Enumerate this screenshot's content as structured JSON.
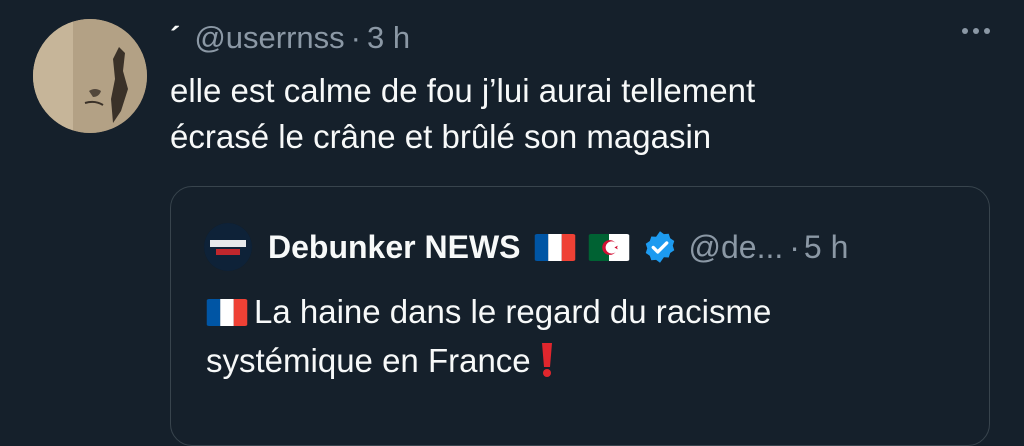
{
  "tweet": {
    "display_name": "´",
    "handle": "@userrnss",
    "separator": "·",
    "time": "3 h",
    "text_line1": "elle est calme de fou j’lui aurai tellement",
    "text_line2": "écrasé le crâne et brûlé son magasin",
    "more_icon": "ellipsis-icon"
  },
  "quote": {
    "avatar_label": "DEBUNKER NEWS",
    "display_name": "Debunker NEWS",
    "flags": [
      "france-flag-icon",
      "algeria-flag-icon"
    ],
    "verified_icon": "verified-badge-icon",
    "verified_color": "#1d9bf0",
    "handle": "@de...",
    "separator": "·",
    "time": "5 h",
    "text_line1": "La haine dans le regard du racisme",
    "text_line2": "systémique en France",
    "leading_icon": "france-flag-icon",
    "trailing_icon": "red-exclamation-icon"
  },
  "colors": {
    "background": "#15202b",
    "primary_text": "#f7f9f9",
    "secondary_text": "#8b98a5",
    "border": "#38444d"
  }
}
